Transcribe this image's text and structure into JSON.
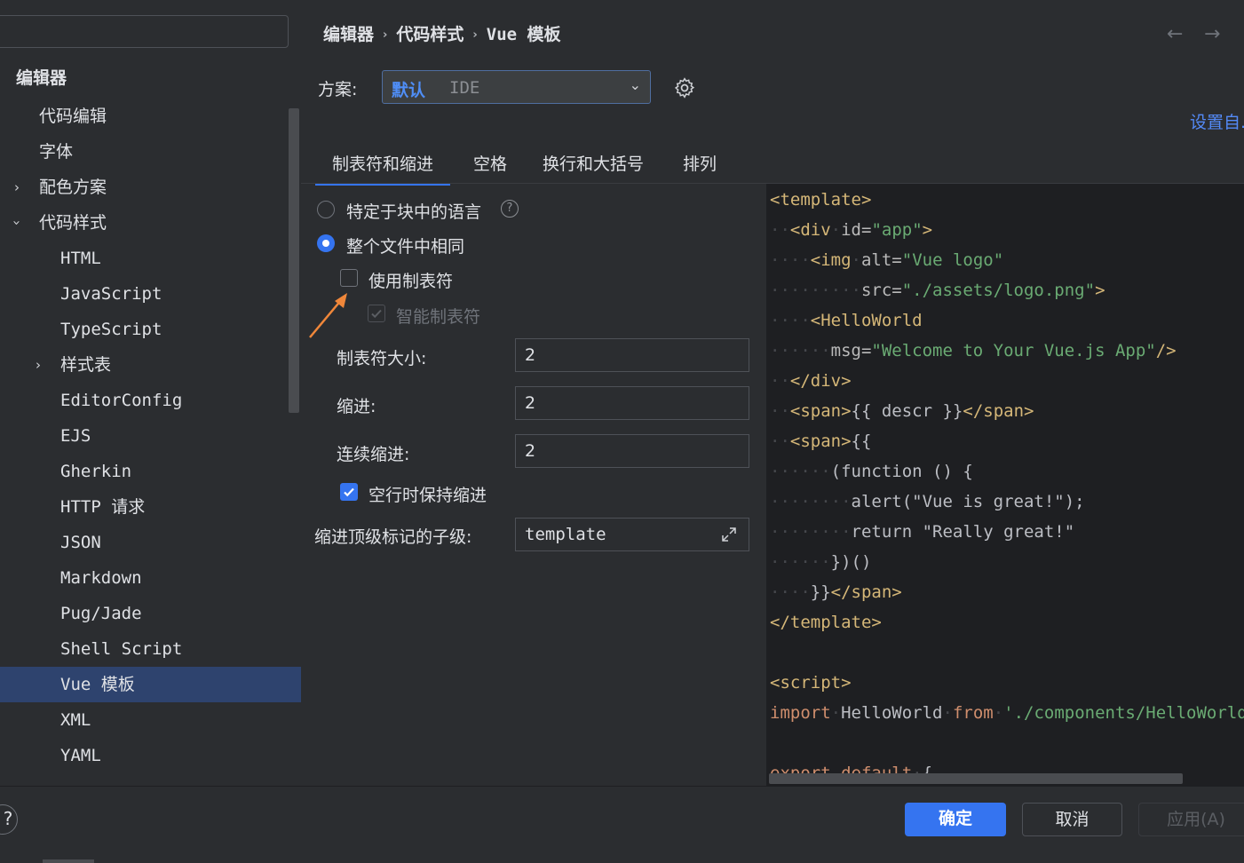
{
  "search": {
    "value": ""
  },
  "sidebar": {
    "section_title": "编辑器",
    "items": [
      {
        "label": "代码编辑"
      },
      {
        "label": "字体"
      },
      {
        "label": "配色方案"
      },
      {
        "label": "代码样式"
      },
      {
        "label": "HTML"
      },
      {
        "label": "JavaScript"
      },
      {
        "label": "TypeScript"
      },
      {
        "label": "样式表"
      },
      {
        "label": "EditorConfig"
      },
      {
        "label": "EJS"
      },
      {
        "label": "Gherkin"
      },
      {
        "label": "HTTP 请求"
      },
      {
        "label": "JSON"
      },
      {
        "label": "Markdown"
      },
      {
        "label": "Pug/Jade"
      },
      {
        "label": "Shell Script"
      },
      {
        "label": "Vue 模板"
      },
      {
        "label": "XML"
      },
      {
        "label": "YAML"
      }
    ],
    "selected_item": "Vue 模板"
  },
  "breadcrumb": {
    "part1": "编辑器",
    "part2": "代码样式",
    "part3": "Vue 模板"
  },
  "scheme": {
    "label": "方案:",
    "primary": "默认",
    "secondary": "IDE"
  },
  "set_from_link": "设置自...",
  "tabs": [
    {
      "label": "制表符和缩进"
    },
    {
      "label": "空格"
    },
    {
      "label": "换行和大括号"
    },
    {
      "label": "排列"
    }
  ],
  "options": {
    "radio_language_specific": "特定于块中的语言",
    "radio_same_whole_file": "整个文件中相同",
    "use_tab_character": "使用制表符",
    "smart_tabs": "智能制表符",
    "tab_size_label": "制表符大小:",
    "tab_size_value": "2",
    "indent_label": "缩进:",
    "indent_value": "2",
    "continuation_label": "连续缩进:",
    "continuation_value": "2",
    "keep_indents_label": "空行时保持缩进",
    "indent_children_label": "缩进顶级标记的子级:",
    "indent_children_value": "template"
  },
  "code": {
    "l1": "<template>",
    "l2_tag": "<div",
    "l2_attr": "id=",
    "l2_str": "\"app\"",
    "l2_end": ">",
    "l3_tag": "<img",
    "l3_attr": "alt=",
    "l3_str": "\"Vue logo\"",
    "l4_attr": "src=",
    "l4_str": "\"./assets/logo.png\"",
    "l4_end": ">",
    "l5_tag": "<HelloWorld",
    "l6_attr": "msg=",
    "l6_str": "\"Welcome to Your Vue.js App\"",
    "l6_end": "/>",
    "l7": "</div>",
    "l8_open": "<span>",
    "l8_text": "{{ descr }}",
    "l8_close": "</span>",
    "l9_open": "<span>",
    "l9_text": "{{",
    "l10": "(function () {",
    "l11": "alert(\"Vue is great!\");",
    "l12": "return \"Really great!\"",
    "l13": "})()",
    "l14_text": "}}",
    "l14_close": "</span>",
    "l15": "</template>",
    "l17": "<script>",
    "l18_kw": "import",
    "l18_name": "HelloWorld",
    "l18_from": "from",
    "l18_str": "'./components/HelloWorld.vue'",
    "l20_kw": "export default",
    "l20_brace": "{"
  },
  "footer": {
    "help": "?",
    "ok": "确定",
    "cancel": "取消",
    "apply": "应用(A)"
  },
  "colors": {
    "accent": "#3574f0",
    "selected_row": "#2e436e",
    "link": "#548af7",
    "annotation_arrow": "#f0873a"
  }
}
